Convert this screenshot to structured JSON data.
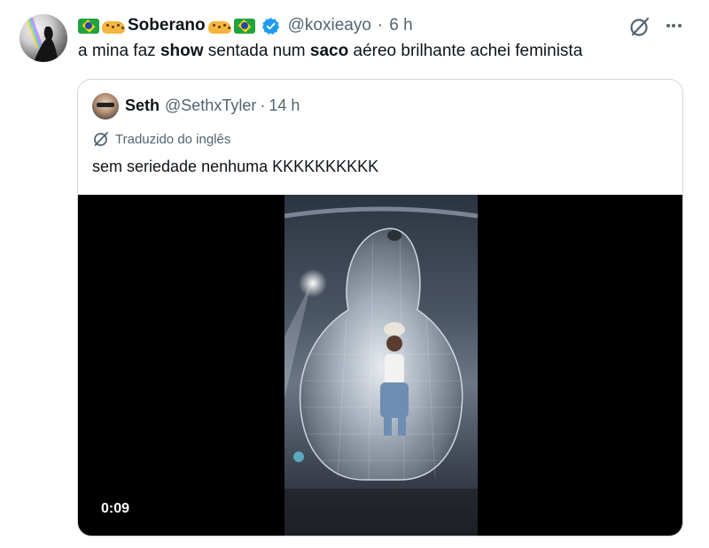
{
  "tweet": {
    "display_name": "Soberano",
    "handle": "@koxieayo",
    "separator": "·",
    "time": "6 h",
    "text_parts": [
      "a mina faz ",
      "show",
      " sentada num ",
      "saco",
      " aéreo brilhante achei feminista"
    ]
  },
  "quote": {
    "display_name": "Seth",
    "handle": "@SethxTyler",
    "separator": "·",
    "time": "14 h",
    "translated_label": "Traduzido do inglês",
    "text": "sem seriedade nenhuma KKKKKKKKKK",
    "video_duration": "0:09"
  },
  "icons": {
    "verified": "verified-badge-icon",
    "grok": "grok-icon",
    "more": "more-icon",
    "translate": "translate-icon"
  },
  "colors": {
    "verified": "#1d9bf0",
    "secondary_text": "#536471",
    "border": "#cfd9de"
  }
}
